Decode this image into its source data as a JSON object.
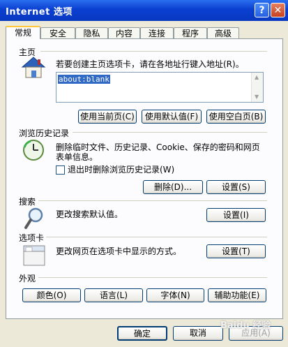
{
  "window": {
    "title": "Internet 选项",
    "help": "?",
    "close": "✕"
  },
  "tabs": [
    "常规",
    "安全",
    "隐私",
    "内容",
    "连接",
    "程序",
    "高级"
  ],
  "home": {
    "label": "主页",
    "desc": "若要创建主页选项卡，请在各地址行键入地址(R)。",
    "url": "about:blank",
    "btn_current": "使用当前页(C)",
    "btn_default": "使用默认值(F)",
    "btn_blank": "使用空白页(B)"
  },
  "history": {
    "label": "浏览历史记录",
    "desc1": "删除临时文件、历史记录、Cookie、保存的密码和网页",
    "desc2": "表单信息。",
    "checkbox": "退出时删除浏览历史记录(W)",
    "btn_delete": "删除(D)...",
    "btn_settings": "设置(S)"
  },
  "search": {
    "label": "搜索",
    "desc": "更改搜索默认值。",
    "btn_settings": "设置(I)"
  },
  "tabs_section": {
    "label": "选项卡",
    "desc": "更改网页在选项卡中显示的方式。",
    "btn_settings": "设置(T)"
  },
  "appearance": {
    "label": "外观",
    "btn_colors": "颜色(O)",
    "btn_languages": "语言(L)",
    "btn_fonts": "字体(N)",
    "btn_accessibility": "辅助功能(E)"
  },
  "footer": {
    "ok": "确定",
    "cancel": "取消",
    "apply": "应用(A)"
  },
  "watermark": "Baidu 经验"
}
